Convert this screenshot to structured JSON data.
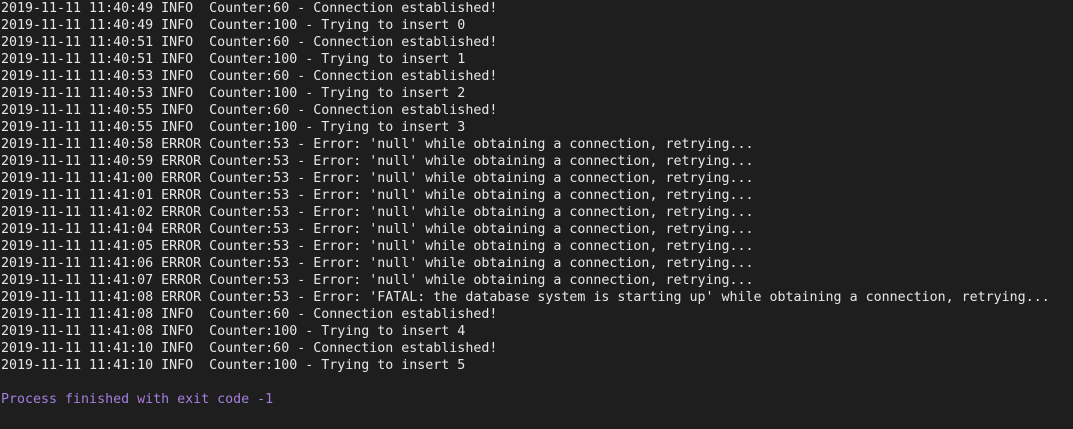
{
  "console": {
    "lines": [
      "2019-11-11 11:40:49 INFO  Counter:60 - Connection established!",
      "2019-11-11 11:40:49 INFO  Counter:100 - Trying to insert 0",
      "2019-11-11 11:40:51 INFO  Counter:60 - Connection established!",
      "2019-11-11 11:40:51 INFO  Counter:100 - Trying to insert 1",
      "2019-11-11 11:40:53 INFO  Counter:60 - Connection established!",
      "2019-11-11 11:40:53 INFO  Counter:100 - Trying to insert 2",
      "2019-11-11 11:40:55 INFO  Counter:60 - Connection established!",
      "2019-11-11 11:40:55 INFO  Counter:100 - Trying to insert 3",
      "2019-11-11 11:40:58 ERROR Counter:53 - Error: 'null' while obtaining a connection, retrying...",
      "2019-11-11 11:40:59 ERROR Counter:53 - Error: 'null' while obtaining a connection, retrying...",
      "2019-11-11 11:41:00 ERROR Counter:53 - Error: 'null' while obtaining a connection, retrying...",
      "2019-11-11 11:41:01 ERROR Counter:53 - Error: 'null' while obtaining a connection, retrying...",
      "2019-11-11 11:41:02 ERROR Counter:53 - Error: 'null' while obtaining a connection, retrying...",
      "2019-11-11 11:41:04 ERROR Counter:53 - Error: 'null' while obtaining a connection, retrying...",
      "2019-11-11 11:41:05 ERROR Counter:53 - Error: 'null' while obtaining a connection, retrying...",
      "2019-11-11 11:41:06 ERROR Counter:53 - Error: 'null' while obtaining a connection, retrying...",
      "2019-11-11 11:41:07 ERROR Counter:53 - Error: 'null' while obtaining a connection, retrying...",
      "2019-11-11 11:41:08 ERROR Counter:53 - Error: 'FATAL: the database system is starting up' while obtaining a connection, retrying...",
      "2019-11-11 11:41:08 INFO  Counter:60 - Connection established!",
      "2019-11-11 11:41:08 INFO  Counter:100 - Trying to insert 4",
      "2019-11-11 11:41:10 INFO  Counter:60 - Connection established!",
      "2019-11-11 11:41:10 INFO  Counter:100 - Trying to insert 5"
    ],
    "exit_message": "Process finished with exit code -1"
  },
  "colors": {
    "background": "#1e1e1e",
    "text": "#e6e6e6",
    "exit_message": "#a47fe0"
  }
}
